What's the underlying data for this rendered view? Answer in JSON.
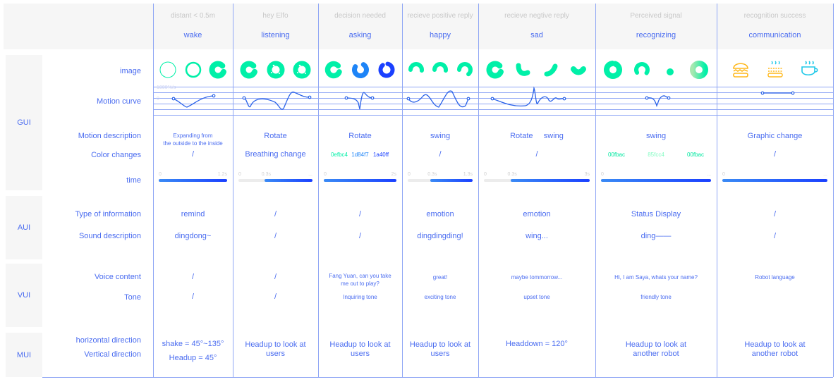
{
  "sections": [
    "GUI",
    "AUI",
    "VUI",
    "MUI"
  ],
  "row_labels": {
    "image": "image",
    "motion_curve": "Motion curve",
    "motion_description": "Motion description",
    "color_changes": "Color changes",
    "time": "time",
    "type_of_information": "Type of information",
    "sound_description": "Sound description",
    "voice_content": "Voice content",
    "tone": "Tone",
    "horizontal_direction": "horizontal direction",
    "vertical_direction": "Vertical direction"
  },
  "motion_axis": {
    "top": "1000%/s",
    "zero": "0"
  },
  "colors": {
    "accent": "#4a6cf0",
    "green": "#00f0a8",
    "blue": "#1d84f7",
    "deep_blue": "#1a40ff",
    "orange": "#ffb81c",
    "cyan": "#1ec8e8"
  },
  "columns": [
    {
      "trigger": "distant < 0.5m",
      "state": "wake",
      "images": [
        "thin-ring-icon",
        "ring-icon",
        "c-donut-icon"
      ],
      "motion": "Expanding from\nthe outside to the inside",
      "color_changes": [
        "/"
      ],
      "time": {
        "ticks": [
          "0",
          "1.2s"
        ],
        "active_start": 0
      },
      "type": "remind",
      "sound": "dingdong~",
      "voice": "/",
      "tone": "/",
      "mui": "shake = 45°~135°\nHeadup = 45°"
    },
    {
      "trigger": "hey Elfo",
      "state": "listening",
      "images": [
        "c-donut-icon",
        "textured-donut-icon",
        "textured-donut-icon"
      ],
      "motion": "Rotate",
      "color_changes": [
        "Breathing change"
      ],
      "time": {
        "ticks": [
          "0",
          "0.3s",
          "..."
        ],
        "active_start": 0.35
      },
      "type": "/",
      "sound": "/",
      "voice": "/",
      "tone": "/",
      "mui": "Headup to look at\nusers"
    },
    {
      "trigger": "decision needed",
      "state": "asking",
      "images": [
        "c-donut-green-icon",
        "swirl-blue-icon",
        "swirl-deepblue-icon"
      ],
      "motion": "Rotate",
      "color_changes": [
        "0efbc4",
        "1d84f7",
        "1a40ff"
      ],
      "time": {
        "ticks": [
          "0",
          "2s"
        ],
        "active_start": 0
      },
      "type": "/",
      "sound": "/",
      "voice": "Fang Yuan, can you take\nme out to play?",
      "tone": "Inquiring tone",
      "mui": "Headup to look at\nusers"
    },
    {
      "trigger": "recieve positive reply",
      "state": "happy",
      "images": [
        "arch-icon",
        "arch-icon",
        "hook-arch-icon"
      ],
      "motion": "swing",
      "color_changes": [
        "/"
      ],
      "time": {
        "ticks": [
          "0",
          "0.3s",
          "1.3s"
        ],
        "active_start": 0.35
      },
      "type": "emotion",
      "sound": "dingdingding!",
      "voice": "great!",
      "tone": "exciting tone",
      "mui": "Headup to look at\nusers"
    },
    {
      "trigger": "recieve negtive reply",
      "state": "sad",
      "images": [
        "c-donut-icon",
        "bean-icon",
        "bean-tilt-icon",
        "bean-flat-icon"
      ],
      "motion": "Rotate     swing",
      "color_changes": [
        "/"
      ],
      "time": {
        "ticks": [
          "0",
          "0.3s",
          "3s"
        ],
        "active_start": 0.25
      },
      "type": "emotion",
      "sound": "wing...",
      "voice": "maybe tommorrow...",
      "tone": "upset tone",
      "mui": "Headdown = 120°"
    },
    {
      "trigger": "Perceived signal",
      "state": "recognizing",
      "images": [
        "donut-icon",
        "c-arc-icon",
        "dot-icon",
        "gradient-donut-icon"
      ],
      "motion": "swing",
      "color_changes": [
        "00fbac",
        "85fcc4",
        "00fbac"
      ],
      "time": {
        "ticks": [
          "0",
          "..."
        ],
        "active_start": 0
      },
      "type": "Status Display",
      "sound": "ding——",
      "voice": "Hi,  I am Saya, whats your name?",
      "tone": "friendly tone",
      "mui": "Headup to look at\nanother robot"
    },
    {
      "trigger": "recognition success",
      "state": "communication",
      "images": [
        "burger-icon",
        "hot-food-icon",
        "coffee-cup-icon"
      ],
      "motion": "Graphic change",
      "color_changes": [
        "/"
      ],
      "time": {
        "ticks": [
          "0",
          "..."
        ],
        "active_start": 0
      },
      "type": "/",
      "sound": "/",
      "voice": "Robot language",
      "tone": "",
      "mui": "Headup to look at\nanother robot"
    }
  ]
}
